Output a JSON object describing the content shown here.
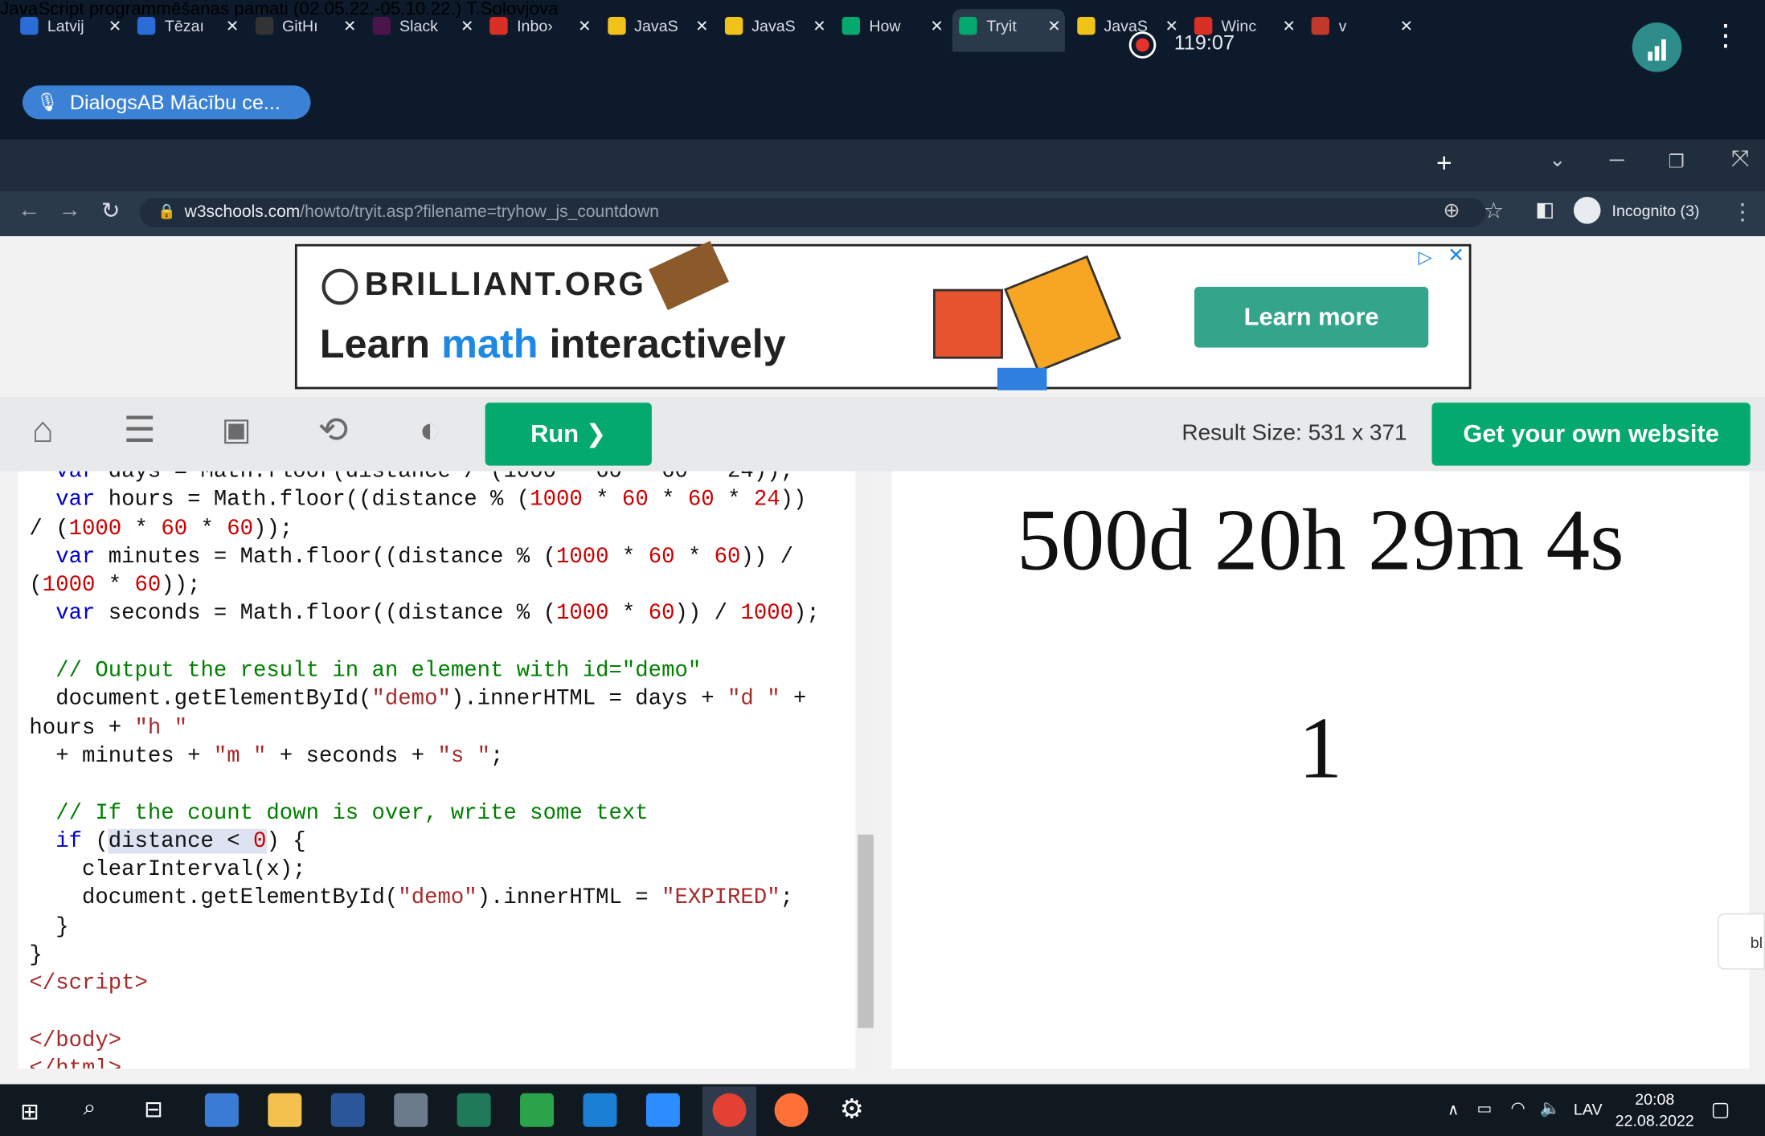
{
  "meeting": {
    "title": "JavaScript programmēšanas pamati (02.05.22.-05.10.22.) T.Solovjova",
    "timer": "119:07",
    "speaker": "DialogsAB Mācību ce..."
  },
  "tabs": [
    {
      "label": "Latvij",
      "icon": "T"
    },
    {
      "label": "Tēzaı",
      "icon": "T"
    },
    {
      "label": "GitHı",
      "icon": "github"
    },
    {
      "label": "Slack",
      "icon": "slack"
    },
    {
      "label": "Inbo›",
      "icon": "M"
    },
    {
      "label": "JavaS",
      "icon": "JS"
    },
    {
      "label": "JavaS",
      "icon": "JS"
    },
    {
      "label": "How",
      "icon": "W"
    },
    {
      "label": "Tryit",
      "icon": "W"
    },
    {
      "label": "JavaS",
      "icon": "JS"
    },
    {
      "label": "Winc",
      "icon": "M"
    },
    {
      "label": "v",
      "icon": "rec"
    }
  ],
  "browser": {
    "host": "w3schools.com",
    "path": "/howto/tryit.asp?filename=tryhow_js_countdown",
    "incognito": "Incognito (3)"
  },
  "ad": {
    "brand": "BRILLIANT.ORG",
    "headline_a": "Learn ",
    "headline_b": "math",
    "headline_c": " interactively",
    "cta": "Learn more"
  },
  "toolbar": {
    "run": "Run ❯",
    "result_size": "Result Size: 531 x 371",
    "own_website": "Get your own website"
  },
  "result": {
    "countdown": "500d 20h 29m 4s",
    "second_line": "1",
    "side_tab": "bl"
  },
  "taskbar": {
    "lang": "LAV",
    "time": "20:08",
    "date": "22.08.2022"
  }
}
